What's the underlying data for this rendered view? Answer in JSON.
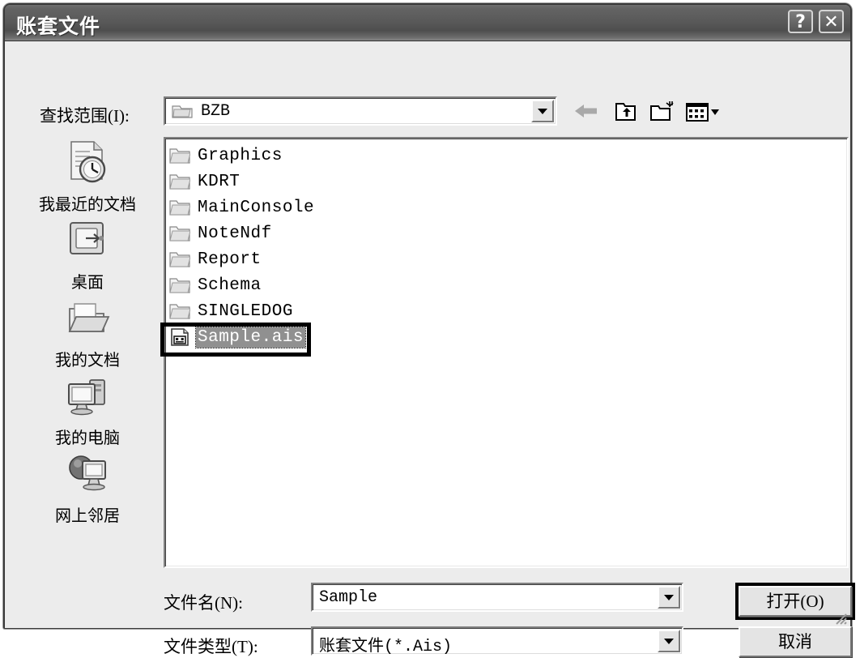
{
  "window": {
    "title": "账套文件",
    "help_button": "?",
    "close_button": "✕"
  },
  "lookin": {
    "label": "查找范围(I):",
    "value": "BZB",
    "folder_icon": "folder-icon",
    "dropdown_icon": "chevron-down-icon"
  },
  "toolbar": {
    "back": "back-arrow-icon",
    "up": "up-one-level-icon",
    "new_folder": "new-folder-icon",
    "views": "views-menu-icon"
  },
  "places": [
    {
      "label": "我最近的文档",
      "icon": "recent-documents-icon"
    },
    {
      "label": "桌面",
      "icon": "desktop-icon"
    },
    {
      "label": "我的文档",
      "icon": "my-documents-icon"
    },
    {
      "label": "我的电脑",
      "icon": "my-computer-icon"
    },
    {
      "label": "网上邻居",
      "icon": "network-places-icon"
    }
  ],
  "files": [
    {
      "name": "Graphics",
      "type": "folder",
      "selected": false
    },
    {
      "name": "KDRT",
      "type": "folder",
      "selected": false
    },
    {
      "name": "MainConsole",
      "type": "folder",
      "selected": false
    },
    {
      "name": "NoteNdf",
      "type": "folder",
      "selected": false
    },
    {
      "name": "Report",
      "type": "folder",
      "selected": false
    },
    {
      "name": "Schema",
      "type": "folder",
      "selected": false
    },
    {
      "name": "SINGLEDOG",
      "type": "folder",
      "selected": false
    },
    {
      "name": "Sample.ais",
      "type": "ais-file",
      "selected": true
    }
  ],
  "filename": {
    "label": "文件名(N):",
    "value": "Sample"
  },
  "filetype": {
    "label": "文件类型(T):",
    "value": "账套文件(*.Ais)"
  },
  "buttons": {
    "open": "打开(O)",
    "cancel": "取消"
  },
  "colors": {
    "titlebar": "#595959",
    "dialog_face": "#ececec",
    "selection": "#909090",
    "annotation": "#000000"
  }
}
